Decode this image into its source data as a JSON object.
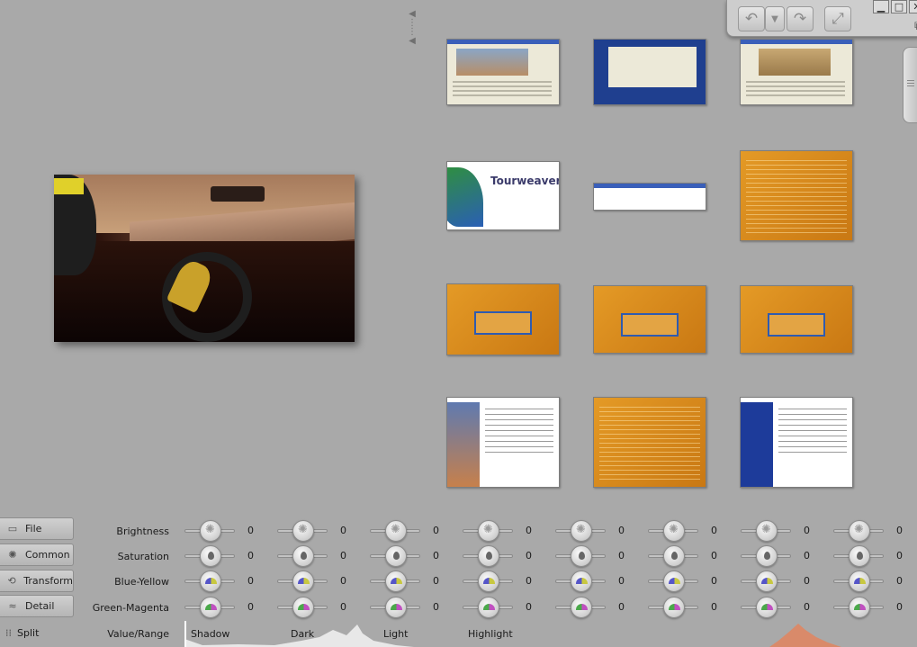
{
  "toolbar": {
    "undo_icon": "undo-icon",
    "dropdown_icon": "chevron-down-icon",
    "redo_icon": "redo-icon",
    "fullscreen_icon": "fullscreen-icon",
    "minimize": "▁",
    "maximize": "□",
    "close": "✕"
  },
  "side_buttons": [
    {
      "label": "File",
      "icon": "folder-icon"
    },
    {
      "label": "Common",
      "icon": "sun-icon"
    },
    {
      "label": "Transform",
      "icon": "rotate-icon"
    },
    {
      "label": "Detail",
      "icon": "detail-icon"
    }
  ],
  "split_label": "Split",
  "rows": [
    {
      "label": "Brightness",
      "knob": "sun",
      "values": [
        "0",
        "0",
        "0",
        "0",
        "0",
        "0",
        "0",
        "0"
      ]
    },
    {
      "label": "Saturation",
      "knob": "drop",
      "values": [
        "0",
        "0",
        "0",
        "0",
        "0",
        "0",
        "0",
        "0"
      ]
    },
    {
      "label": "Blue-Yellow",
      "knob": "by",
      "values": [
        "0",
        "0",
        "0",
        "0",
        "0",
        "0",
        "0",
        "0"
      ]
    },
    {
      "label": "Green-Magenta",
      "knob": "gm",
      "values": [
        "0",
        "0",
        "0",
        "0",
        "0",
        "0",
        "0",
        "0"
      ]
    }
  ],
  "value_range_label": "Value/Range",
  "tones": [
    "Shadow",
    "Dark",
    "Light",
    "Highlight"
  ],
  "thumbnails": [
    {
      "kind": "window"
    },
    {
      "kind": "blue"
    },
    {
      "kind": "window"
    },
    {
      "kind": "tourweaver",
      "text": "Tourweaver"
    },
    {
      "kind": "small"
    },
    {
      "kind": "orange"
    },
    {
      "kind": "orange-panel"
    },
    {
      "kind": "orange-panel"
    },
    {
      "kind": "orange-panel"
    },
    {
      "kind": "wizard"
    },
    {
      "kind": "orange"
    },
    {
      "kind": "wizard-dark"
    }
  ]
}
